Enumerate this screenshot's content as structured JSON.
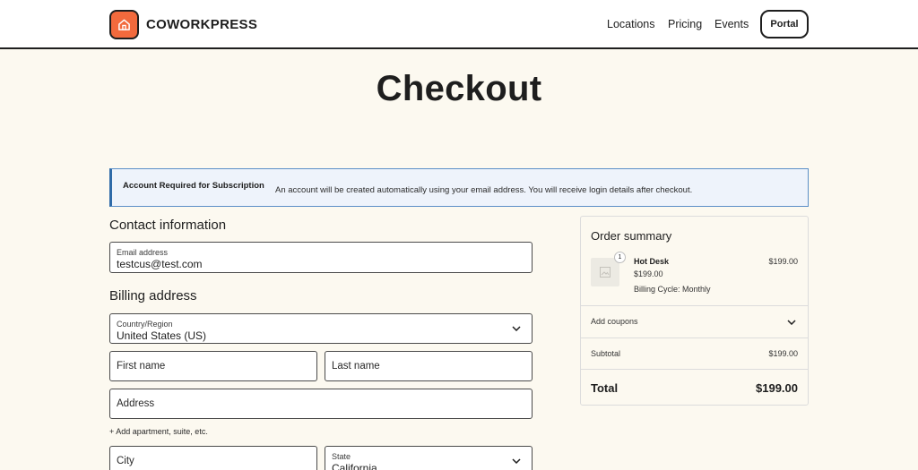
{
  "header": {
    "brand": "COWORKPRESS",
    "logo_icon": "home-icon",
    "nav": [
      "Locations",
      "Pricing",
      "Events"
    ],
    "portal_label": "Portal"
  },
  "page": {
    "title": "Checkout"
  },
  "notice": {
    "title": "Account Required for Subscription",
    "text": "An account will be created automatically using your email address. You will receive login details after checkout."
  },
  "contact": {
    "heading": "Contact information",
    "email_label": "Email address",
    "email_value": "testcus@test.com"
  },
  "billing": {
    "heading": "Billing address",
    "country_label": "Country/Region",
    "country_value": "United States (US)",
    "first_name_placeholder": "First name",
    "last_name_placeholder": "Last name",
    "address_placeholder": "Address",
    "add_apartment": "+ Add apartment, suite, etc.",
    "city_placeholder": "City",
    "state_label": "State",
    "state_value": "California"
  },
  "summary": {
    "title": "Order summary",
    "item": {
      "quantity": "1",
      "name": "Hot Desk",
      "price": "$199.00",
      "cycle": "Billing Cycle: Monthly",
      "line_total": "$199.00"
    },
    "coupons_label": "Add coupons",
    "subtotal_label": "Subtotal",
    "subtotal_value": "$199.00",
    "total_label": "Total",
    "total_value": "$199.00"
  },
  "colors": {
    "accent": "#f26a3d",
    "page_bg": "#fcf9f0",
    "notice_bg": "#eef3fb",
    "notice_border": "#2e6aa8"
  }
}
